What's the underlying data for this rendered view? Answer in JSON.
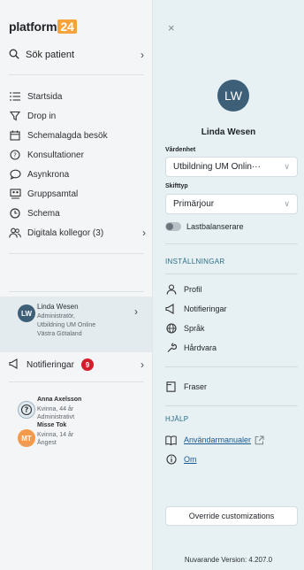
{
  "brand": {
    "name": "platform",
    "number": "24",
    "accent": "#f6a33c"
  },
  "search": {
    "label": "Sök patient"
  },
  "nav": {
    "items": [
      {
        "label": "Startsida",
        "icon": "list-icon"
      },
      {
        "label": "Drop in",
        "icon": "funnel-icon"
      },
      {
        "label": "Schemalagda besök",
        "icon": "calendar-icon"
      },
      {
        "label": "Konsultationer",
        "icon": "question-circle-icon"
      },
      {
        "label": "Asynkrona",
        "icon": "chat-bubbles-icon"
      },
      {
        "label": "Gruppsamtal",
        "icon": "group-chat-icon"
      },
      {
        "label": "Schema",
        "icon": "clock-icon"
      },
      {
        "label": "Digitala kollegor (3)",
        "icon": "people-icon"
      }
    ]
  },
  "user_card": {
    "initials": "LW",
    "name": "Linda Wesen",
    "role": "Administratör,",
    "org": "Utbildning UM Online",
    "region": "Västra Götaland"
  },
  "notifications": {
    "label": "Notifieringar",
    "count": "9",
    "badge_color": "#d11f2e"
  },
  "patients": [
    {
      "name": "Anna Axelsson",
      "line1": "Kvinna, 44 år",
      "line2": "Administrativt",
      "icon": "question-person-icon"
    },
    {
      "initials": "MT",
      "name": "Misse Tok",
      "line1": "Kvinna, 14 år",
      "line2": "Ångest",
      "avatar_color": "#f59a4a"
    }
  ],
  "panel": {
    "close_label": "×",
    "initials": "LW",
    "name": "Linda Wesen",
    "unit_label": "Vårdenhet",
    "unit_value": "Utbildning UM Onlin···",
    "shift_label": "Skifttyp",
    "shift_value": "Primärjour",
    "toggle_label": "Lastbalanserare",
    "settings_header": "INSTÄLLNINGAR",
    "settings_items": [
      {
        "label": "Profil",
        "icon": "person-icon"
      },
      {
        "label": "Notifieringar",
        "icon": "megaphone-icon"
      },
      {
        "label": "Språk",
        "icon": "globe-icon"
      },
      {
        "label": "Hårdvara",
        "icon": "wrench-icon"
      }
    ],
    "fraser_label": "Fraser",
    "help_header": "HJÄLP",
    "manuals_label": "Användarmanualer",
    "about_label": "Om",
    "override_button": "Override customizations",
    "version": "Nuvarande Version: 4.207.0"
  }
}
